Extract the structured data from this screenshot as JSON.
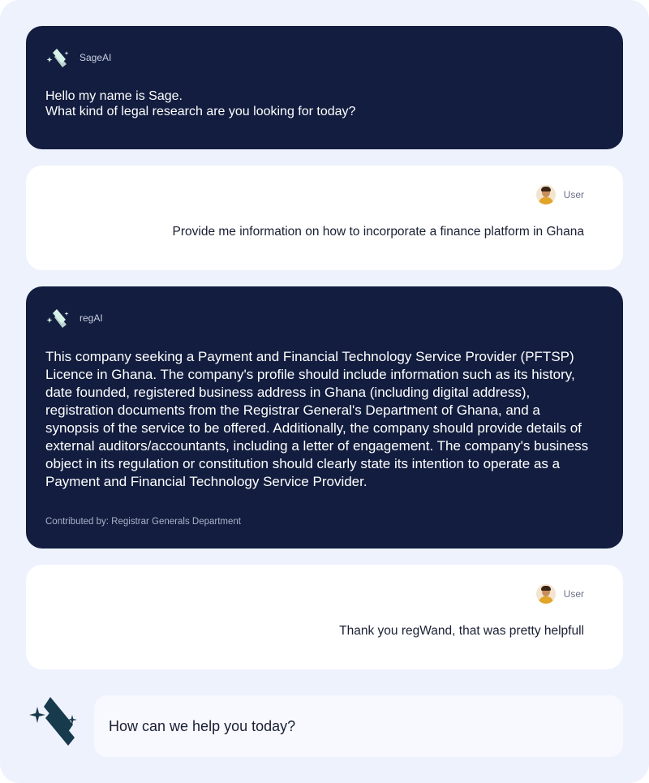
{
  "colors": {
    "background": "#eef2fd",
    "bot_card": "#121d3f",
    "user_card": "#ffffff",
    "logo_light": "#d6f2e6",
    "logo_dark": "#183a4d"
  },
  "messages": [
    {
      "role": "bot",
      "sender": "SageAI",
      "text_lines": [
        "Hello my name is Sage.",
        "What kind of legal research are you looking for today?"
      ]
    },
    {
      "role": "user",
      "sender": "User",
      "text": "Provide me information on how to incorporate a finance platform in Ghana"
    },
    {
      "role": "bot",
      "sender": "regAI",
      "text": "This company seeking a Payment and Financial Technology Service Provider (PFTSP) Licence in Ghana. The company's profile should include information such as its history, date founded, registered business address in Ghana (including digital address), registration documents from the Registrar General's Department of Ghana, and a synopsis of the service to be offered. Additionally, the company should provide details of external auditors/accountants, including a letter of engagement. The company's business object in its regulation or constitution should clearly state its intention to operate as a Payment and Financial Technology Service Provider.",
      "contributed_by": "Contributed by: Registrar Generals Department"
    },
    {
      "role": "user",
      "sender": "User",
      "text": "Thank you regWand, that was pretty helpfull"
    }
  ],
  "composer": {
    "placeholder": "How can we help you today?",
    "logo_icon": "sparkle-n-logo-icon"
  }
}
